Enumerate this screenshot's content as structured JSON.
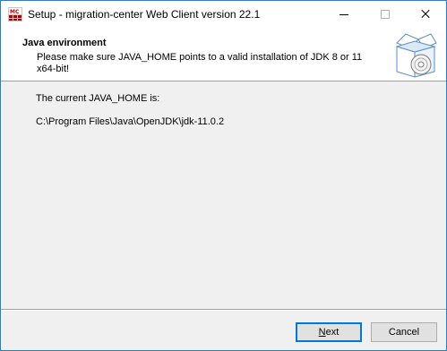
{
  "window": {
    "title": "Setup - migration-center Web Client version 22.1",
    "app_icon": "mc-app-icon",
    "controls": {
      "minimize_icon": "minimize-icon",
      "maximize_icon": "maximize-icon",
      "close_icon": "close-icon"
    }
  },
  "header": {
    "title": "Java environment",
    "description": "Please make sure JAVA_HOME points to a valid installation of JDK 8 or 11 x64-bit!",
    "graphic_icon": "installer-box-icon"
  },
  "content": {
    "current_label": "The current JAVA_HOME is:",
    "java_home_path": "C:\\Program Files\\Java\\OpenJDK\\jdk-11.0.2"
  },
  "buttons": {
    "next_mnemonic": "N",
    "next_rest": "ext",
    "cancel_label": "Cancel"
  },
  "colors": {
    "accent": "#0078d7",
    "window_border": "#1883d7"
  }
}
